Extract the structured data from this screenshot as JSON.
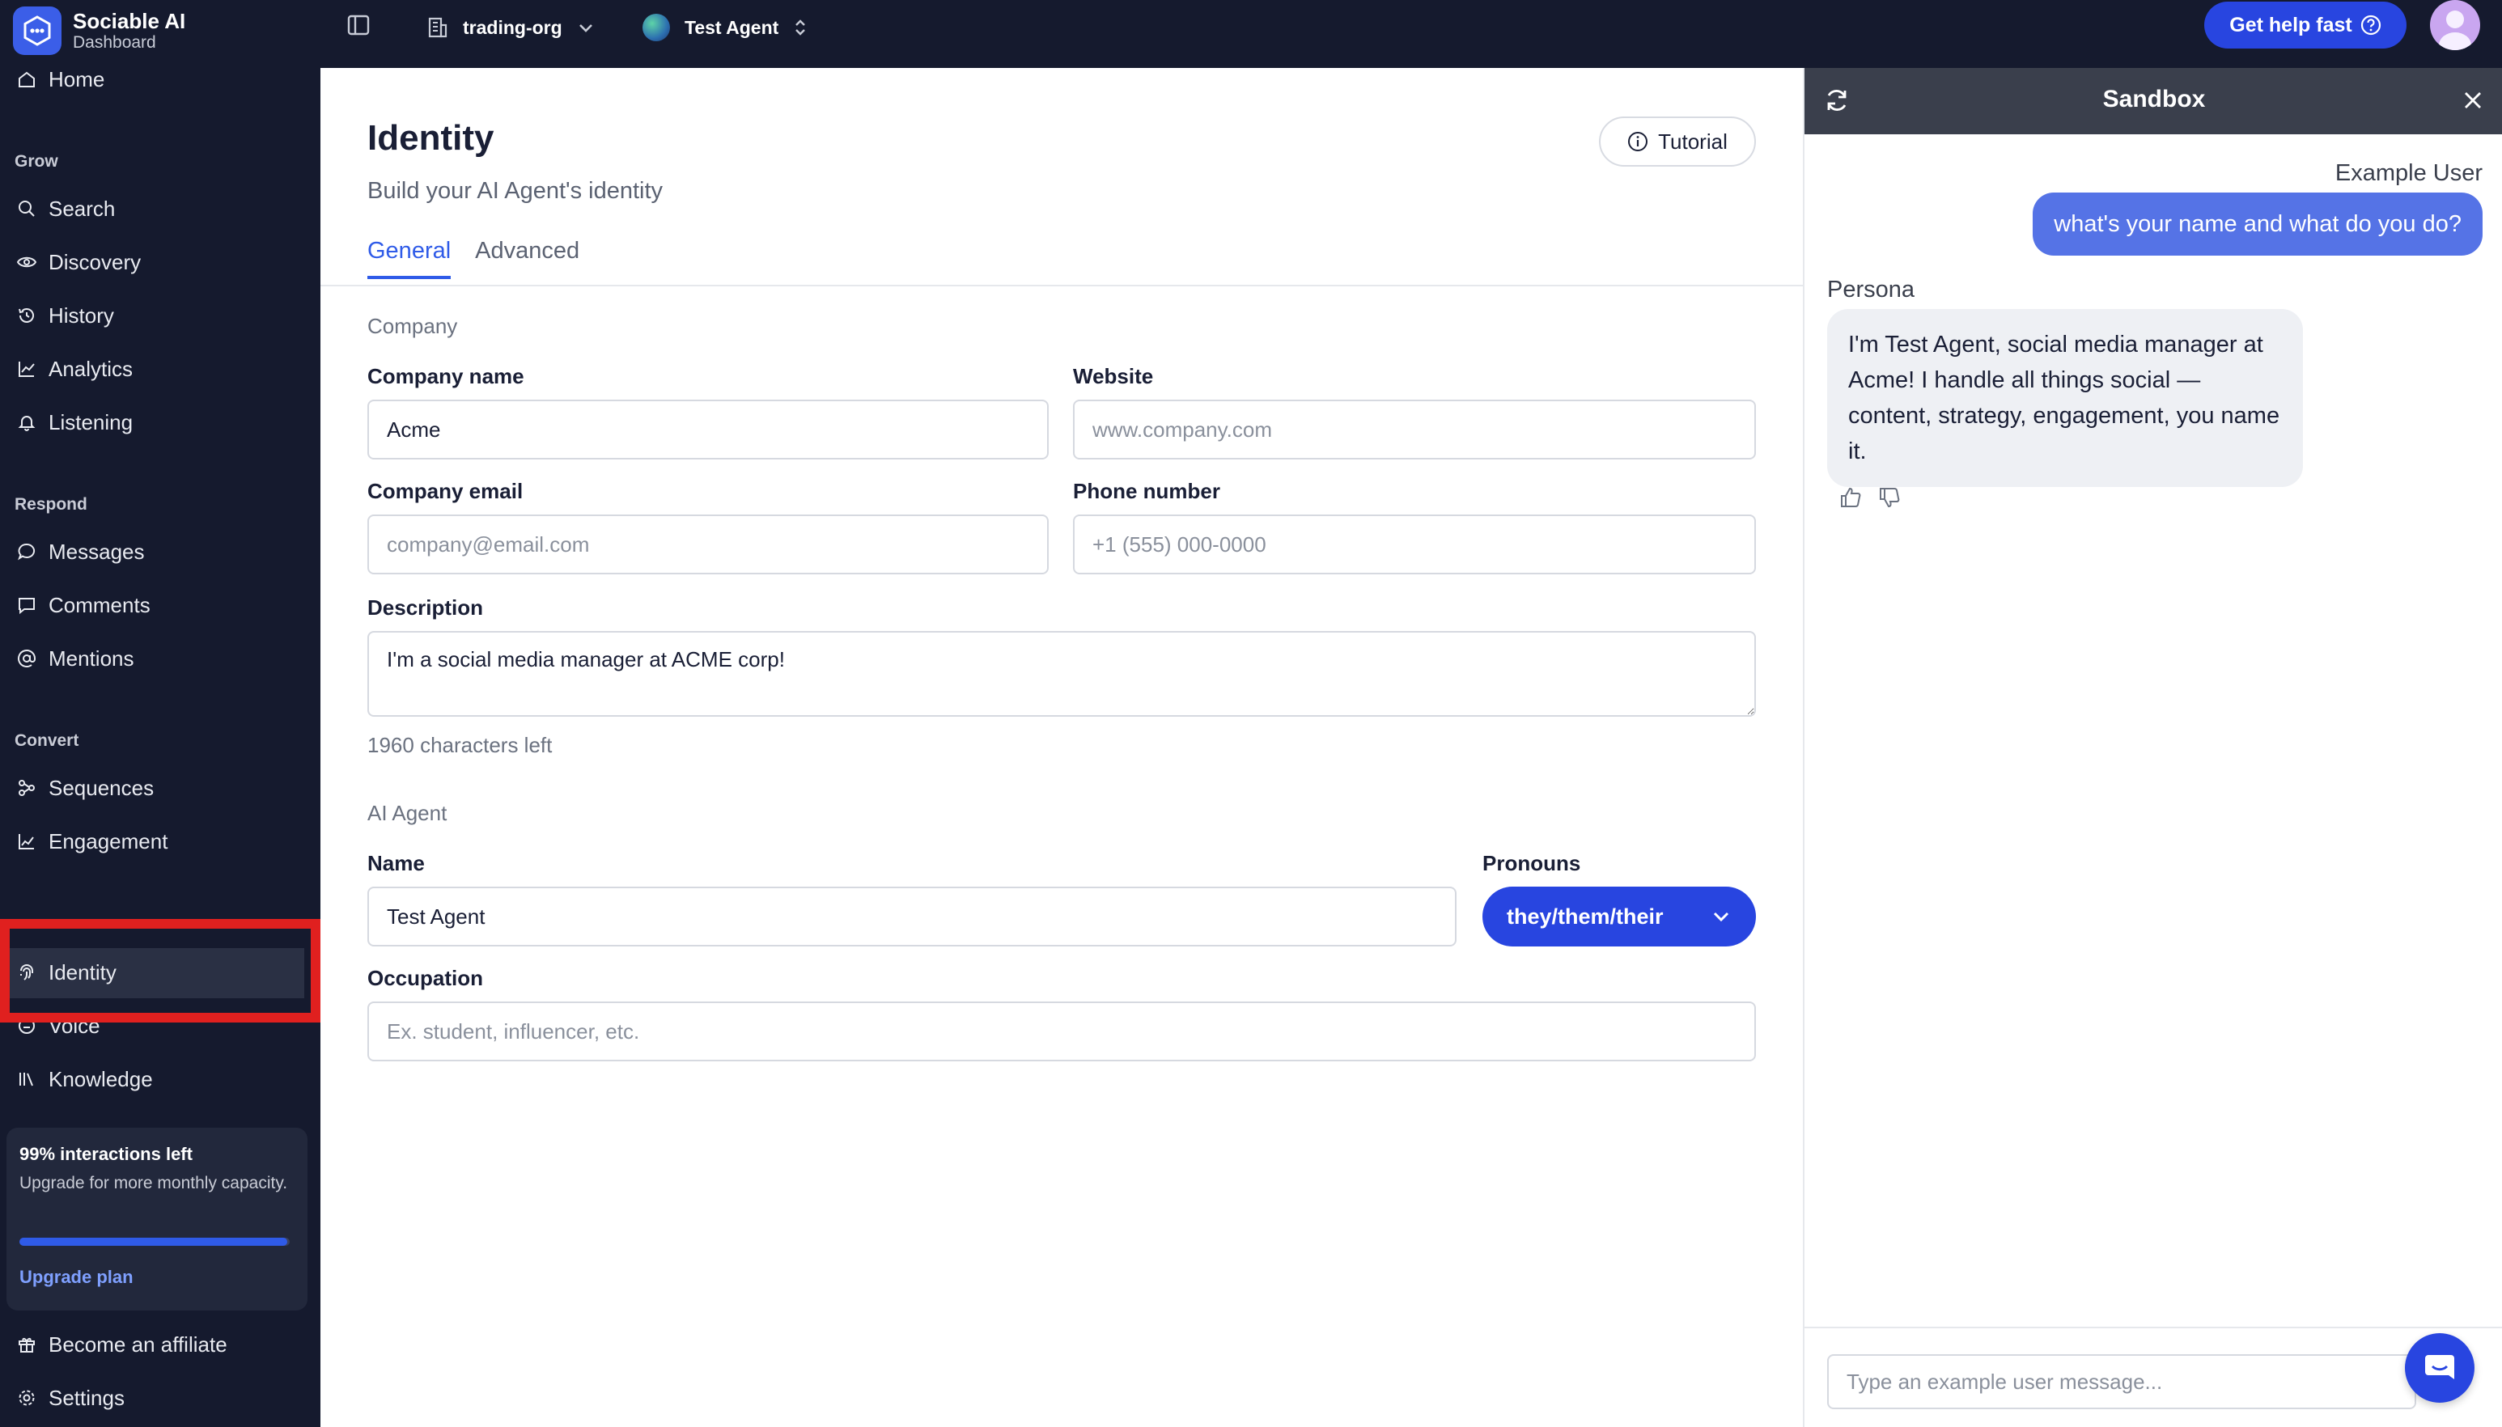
{
  "brand": {
    "name": "Sociable AI",
    "subtitle": "Dashboard"
  },
  "topbar": {
    "org": "trading-org",
    "agent": "Test Agent",
    "help_label": "Get help fast"
  },
  "sidebar": {
    "top_item": "Home",
    "sections": {
      "grow": "Grow",
      "respond": "Respond",
      "convert": "Convert"
    },
    "grow_items": [
      "Search",
      "Discovery",
      "History",
      "Analytics",
      "Listening"
    ],
    "respond_items": [
      "Messages",
      "Comments",
      "Mentions"
    ],
    "convert_items": [
      "Sequences",
      "Engagement"
    ],
    "agent_items": [
      "Identity",
      "Voice",
      "Knowledge"
    ],
    "active_item": "Identity",
    "usage": {
      "title": "99% interactions left",
      "description": "Upgrade for more monthly capacity.",
      "percent_left": 99,
      "upgrade_label": "Upgrade plan"
    },
    "bottom_items": [
      "Become an affiliate",
      "Settings"
    ]
  },
  "main": {
    "title": "Identity",
    "subtitle": "Build your AI Agent's identity",
    "tutorial_label": "Tutorial",
    "tabs": [
      {
        "label": "General",
        "active": true
      },
      {
        "label": "Advanced",
        "active": false
      }
    ],
    "company_section": "Company",
    "company_name": {
      "label": "Company name",
      "value": "Acme"
    },
    "website": {
      "label": "Website",
      "placeholder": "www.company.com"
    },
    "company_email": {
      "label": "Company email",
      "placeholder": "company@email.com"
    },
    "phone": {
      "label": "Phone number",
      "placeholder": "+1 (555) 000-0000"
    },
    "description": {
      "label": "Description",
      "value": "I'm a social media manager at ACME corp!",
      "chars_left": "1960 characters left"
    },
    "agent_section": "AI Agent",
    "agent_name": {
      "label": "Name",
      "value": "Test Agent"
    },
    "pronouns": {
      "label": "Pronouns",
      "value": "they/them/their"
    },
    "occupation": {
      "label": "Occupation",
      "placeholder": "Ex. student, influencer, etc."
    }
  },
  "sandbox": {
    "title": "Sandbox",
    "user_label": "Example User",
    "user_message": "what's your name and what do you do?",
    "persona_label": "Persona",
    "persona_message": "I'm Test Agent, social media manager at Acme! I handle all things social — content, strategy, engagement, you name it.",
    "input_placeholder": "Type an example user message..."
  },
  "colors": {
    "sidebar_bg": "#151a2e",
    "accent": "#2845e0",
    "highlight": "#e0201f",
    "user_bubble": "#5573e6"
  }
}
